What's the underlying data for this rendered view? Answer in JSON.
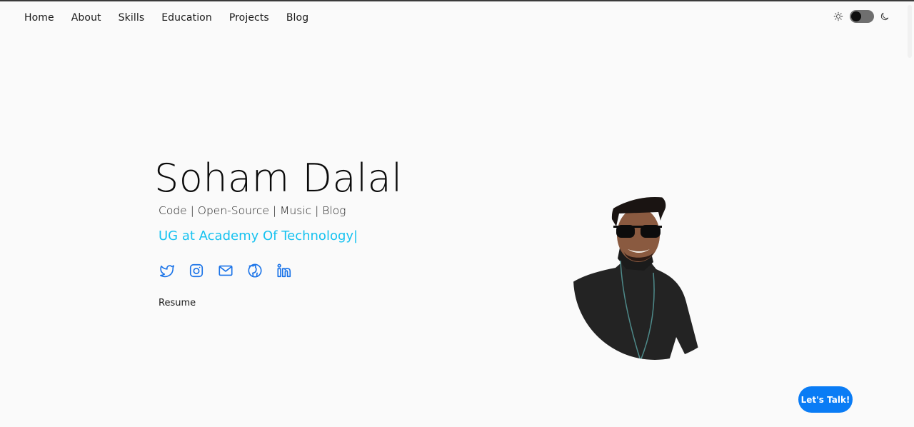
{
  "nav": {
    "links": [
      {
        "label": "Home"
      },
      {
        "label": "About"
      },
      {
        "label": "Skills"
      },
      {
        "label": "Education"
      },
      {
        "label": "Projects"
      },
      {
        "label": "Blog"
      }
    ],
    "theme_toggle": {
      "left_icon": "sun-icon",
      "right_icon": "moon-icon",
      "state": "light"
    }
  },
  "hero": {
    "name": "Soham Dalal",
    "tagline": "Code | Open-Source | Music | Blog",
    "role": "UG at Academy Of Technology|",
    "social": [
      {
        "name": "twitter",
        "icon": "twitter-icon"
      },
      {
        "name": "instagram",
        "icon": "instagram-icon"
      },
      {
        "name": "email",
        "icon": "mail-icon"
      },
      {
        "name": "github",
        "icon": "github-icon"
      },
      {
        "name": "linkedin",
        "icon": "linkedin-icon"
      }
    ],
    "resume_label": "Resume",
    "photo_alt": "Portrait of Soham Dalal"
  },
  "cta": {
    "label": "Let's Talk!"
  },
  "colors": {
    "background": "#fafafa",
    "accent": "#16c2f0",
    "icon_blue": "#1a73e8",
    "button": "#0a7cf5"
  }
}
